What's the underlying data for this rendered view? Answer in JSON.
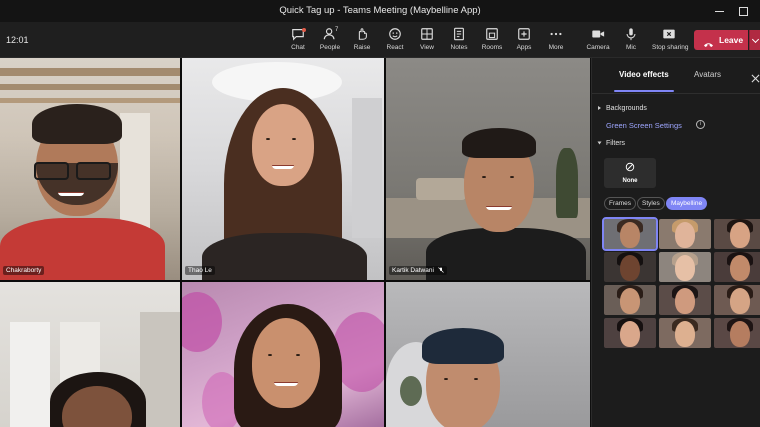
{
  "window": {
    "title": "Quick Tag up - Teams Meeting (Maybelline App)"
  },
  "toolbar": {
    "clock": "12:01",
    "buttons": [
      {
        "label": "Chat",
        "icon": "chat-icon"
      },
      {
        "label": "People",
        "icon": "people-icon",
        "count": "7"
      },
      {
        "label": "Raise",
        "icon": "raise-hand-icon"
      },
      {
        "label": "React",
        "icon": "react-icon"
      },
      {
        "label": "View",
        "icon": "view-icon"
      },
      {
        "label": "Notes",
        "icon": "notes-icon"
      },
      {
        "label": "Rooms",
        "icon": "rooms-icon"
      },
      {
        "label": "Apps",
        "icon": "apps-icon"
      },
      {
        "label": "More",
        "icon": "more-icon"
      },
      {
        "label": "Camera",
        "icon": "camera-icon"
      },
      {
        "label": "Mic",
        "icon": "mic-icon"
      },
      {
        "label": "Stop sharing",
        "icon": "stop-sharing-icon"
      }
    ],
    "leave_label": "Leave",
    "accent_leave": "#c4314b"
  },
  "participants": [
    {
      "name": "Chakraborty",
      "muted": false
    },
    {
      "name": "Thao Le",
      "muted": false
    },
    {
      "name": "Kartik Datwani",
      "muted": true
    },
    {
      "name": "",
      "muted": false
    },
    {
      "name": "",
      "muted": false
    },
    {
      "name": "",
      "muted": false
    }
  ],
  "panel": {
    "tabs": [
      "Video effects",
      "Avatars"
    ],
    "active_tab": "Video effects",
    "backgrounds_label": "Backgrounds",
    "green_screen_label": "Green Screen Settings",
    "filters_label": "Filters",
    "none_label": "None",
    "filter_chips": [
      "Frames",
      "Styles",
      "Maybelline"
    ],
    "active_chip": "Maybelline",
    "accent": "#7f85f5"
  }
}
